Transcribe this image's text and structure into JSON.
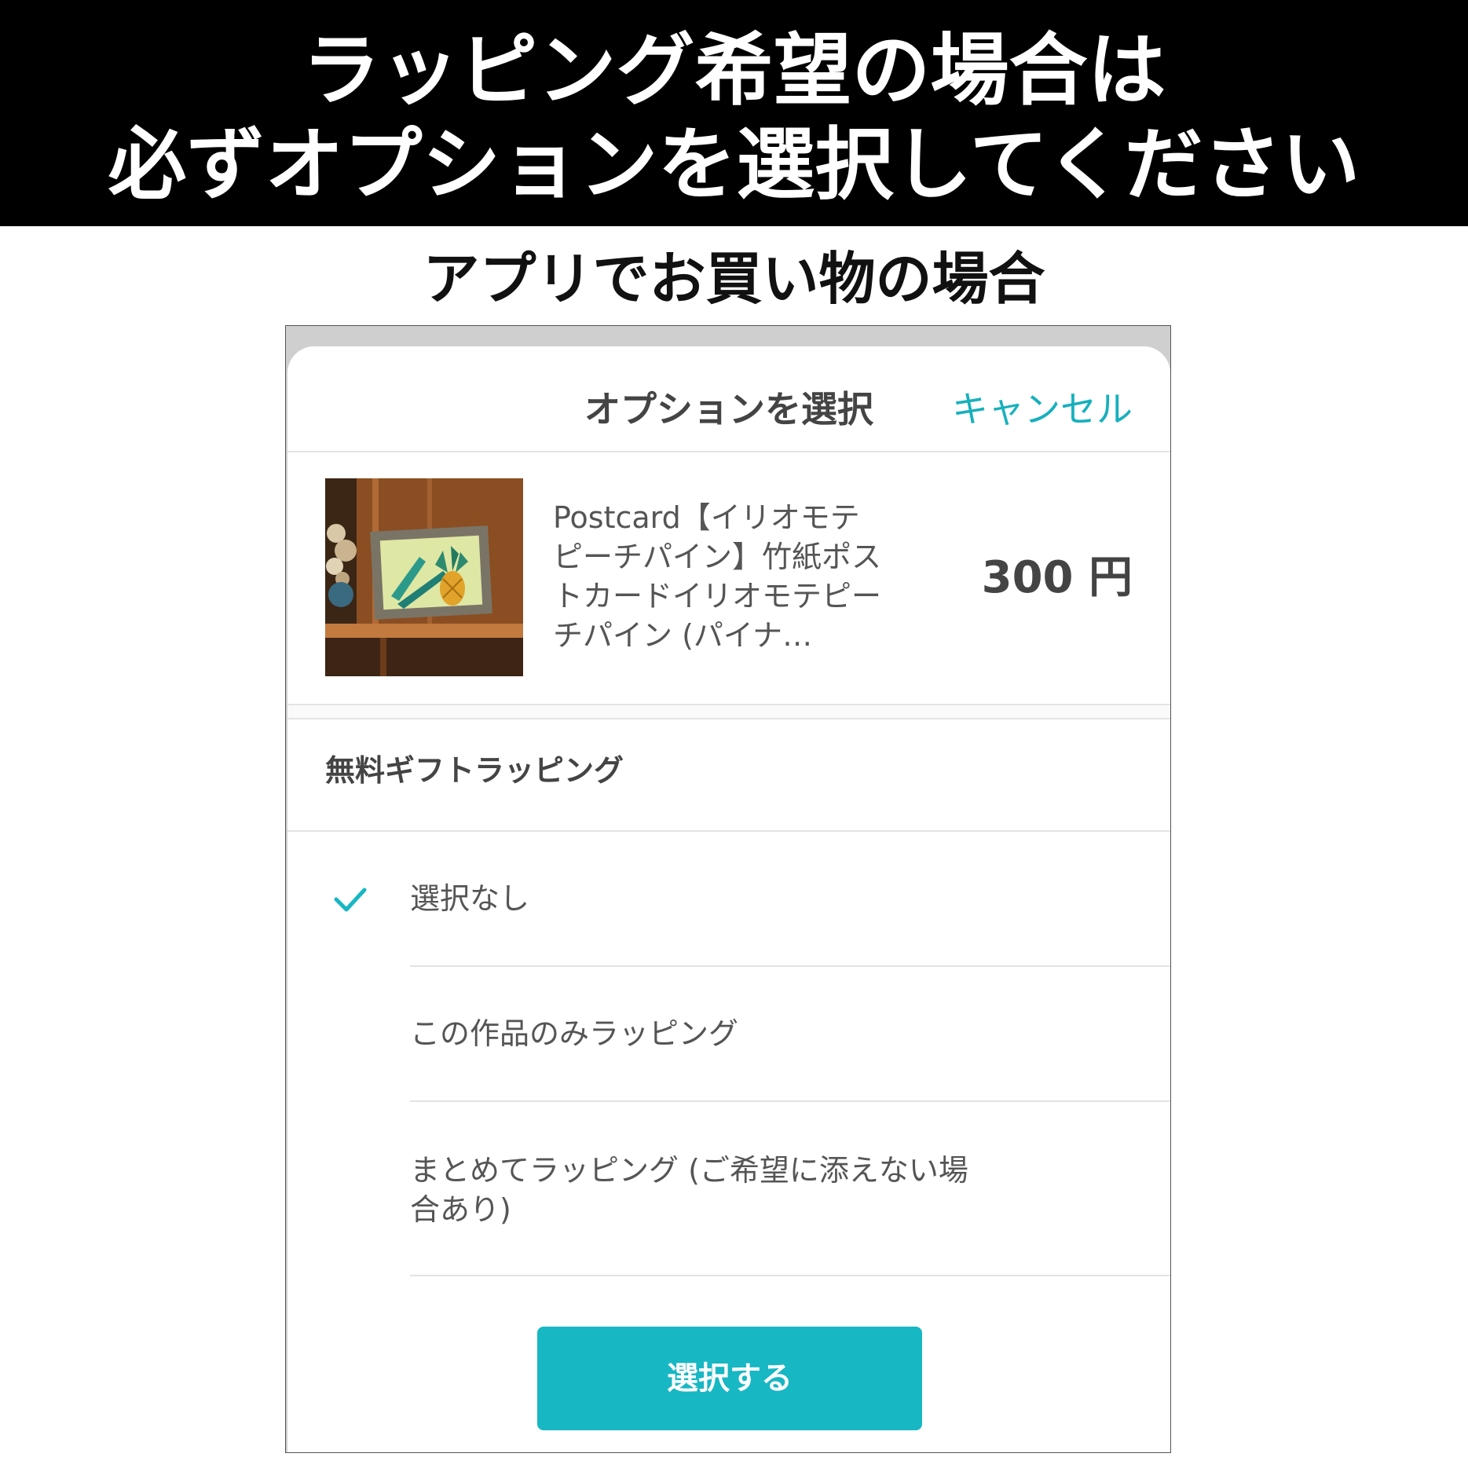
{
  "banner": {
    "line1": "ラッピング希望の場合は",
    "line2": "必ずオプションを選択してください"
  },
  "subtitle": "アプリでお買い物の場合",
  "sheet": {
    "title": "オプションを選択",
    "cancel_label": "キャンセル",
    "product": {
      "name": "Postcard【イリオモテピーチパイン】竹紙ポストカードイリオモテピーチパイン (パイナ…",
      "price": "300 円",
      "image": "pineapple-postcard-photo"
    },
    "option_group": {
      "title": "無料ギフトラッピング",
      "options": [
        {
          "label": "選択なし",
          "selected": true
        },
        {
          "label": "この作品のみラッピング",
          "selected": false
        },
        {
          "label": "まとめてラッピング (ご希望に添えない場合あり)",
          "selected": false
        }
      ]
    },
    "submit_label": "選択する"
  },
  "colors": {
    "accent": "#17b7c3",
    "banner_bg": "#000000",
    "text_gray": "#555555"
  }
}
